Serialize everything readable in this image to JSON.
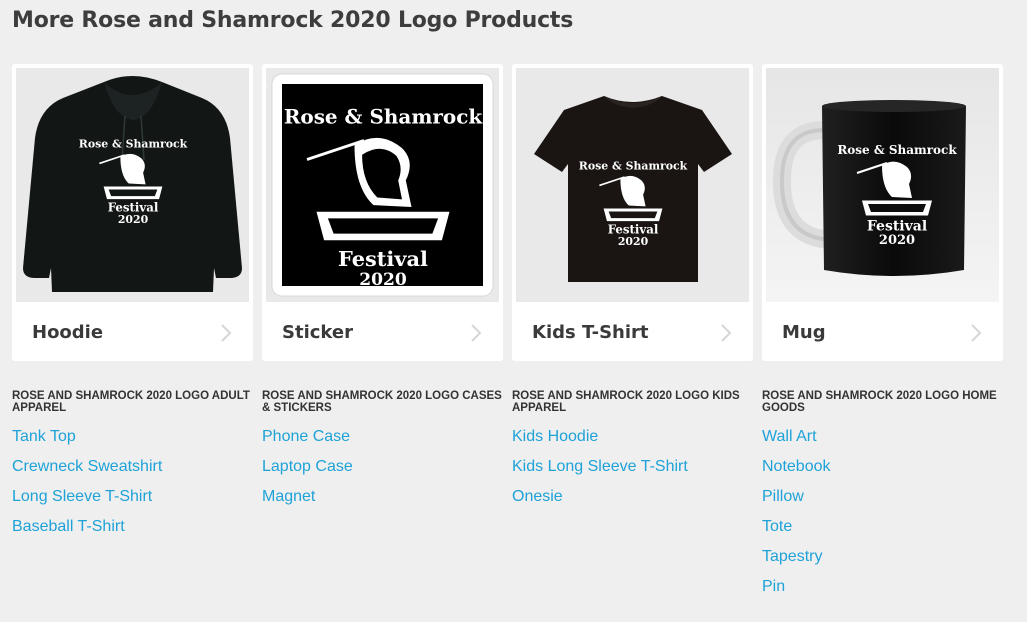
{
  "title": "More Rose and Shamrock 2020 Logo Products",
  "artwork": {
    "line1": "Rose & Shamrock",
    "line2": "Festival",
    "line3": "2020"
  },
  "colors": {
    "link": "#1ea2d8",
    "background": "#efefef",
    "card": "#ffffff"
  },
  "products": [
    {
      "label": "Hoodie",
      "image": "black-hoodie"
    },
    {
      "label": "Sticker",
      "image": "square-sticker"
    },
    {
      "label": "Kids T-Shirt",
      "image": "black-t-shirt"
    },
    {
      "label": "Mug",
      "image": "black-mug"
    }
  ],
  "categories": [
    {
      "heading": "Rose and Shamrock 2020 Logo Adult Apparel",
      "links": [
        "Tank Top",
        "Crewneck Sweatshirt",
        "Long Sleeve T-Shirt",
        "Baseball T-Shirt"
      ]
    },
    {
      "heading": "Rose and Shamrock 2020 Logo Cases & Stickers",
      "links": [
        "Phone Case",
        "Laptop Case",
        "Magnet"
      ]
    },
    {
      "heading": "Rose and Shamrock 2020 Logo Kids Apparel",
      "links": [
        "Kids Hoodie",
        "Kids Long Sleeve T-Shirt",
        "Onesie"
      ]
    },
    {
      "heading": "Rose and Shamrock 2020 Logo Home Goods",
      "links": [
        "Wall Art",
        "Notebook",
        "Pillow",
        "Tote",
        "Tapestry",
        "Pin"
      ]
    }
  ]
}
